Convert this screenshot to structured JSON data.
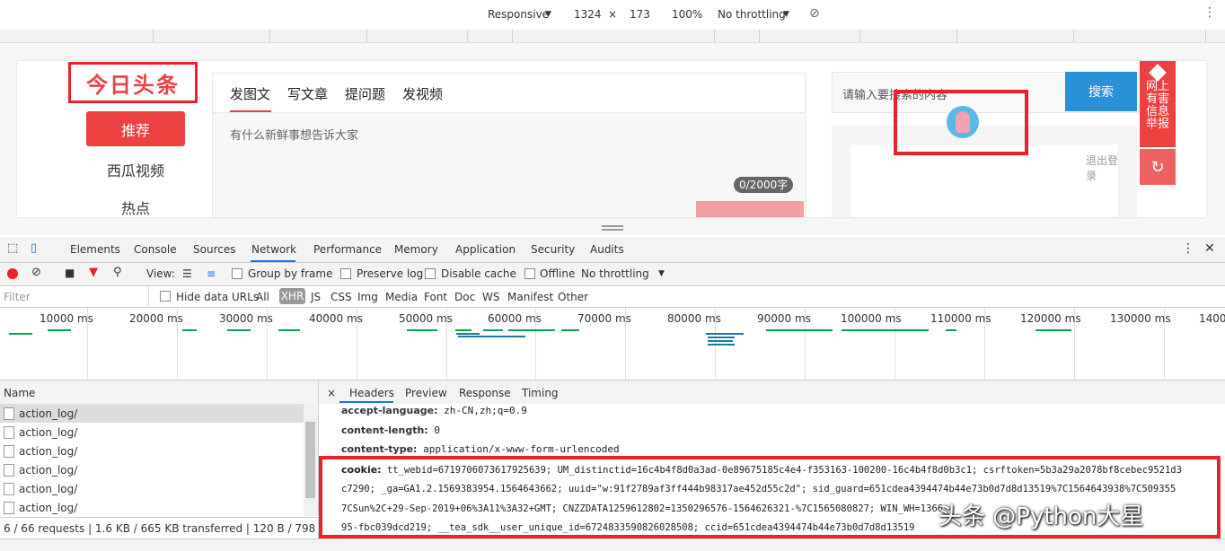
{
  "device_toolbar": {
    "device": "Responsive",
    "width": "1324",
    "times": "×",
    "height": "173",
    "zoom": "100%",
    "throttling": "No throttling"
  },
  "page": {
    "logo": "今日头条",
    "nav": [
      "推荐",
      "西瓜视频",
      "热点"
    ],
    "compose_tabs": [
      "发图文",
      "写文章",
      "提问题",
      "发视频"
    ],
    "compose_placeholder": "有什么新鲜事想告诉大家",
    "counter": "0/2000字",
    "search_placeholder": "请输入要搜索的内容",
    "search_button": "搜索",
    "report": "网上有害信息举报",
    "logout": "退出登录"
  },
  "devtools": {
    "tabs": [
      "Elements",
      "Console",
      "Sources",
      "Network",
      "Performance",
      "Memory",
      "Application",
      "Security",
      "Audits"
    ],
    "toolbar": {
      "view": "View:",
      "group_by_frame": "Group by frame",
      "preserve_log": "Preserve log",
      "disable_cache": "Disable cache",
      "offline": "Offline",
      "throttling": "No throttling"
    },
    "filter": {
      "placeholder": "Filter",
      "hide_data_urls": "Hide data URLs",
      "types": [
        "All",
        "XHR",
        "JS",
        "CSS",
        "Img",
        "Media",
        "Font",
        "Doc",
        "WS",
        "Manifest",
        "Other"
      ]
    },
    "timeline_labels": [
      "10000 ms",
      "20000 ms",
      "30000 ms",
      "40000 ms",
      "50000 ms",
      "60000 ms",
      "70000 ms",
      "80000 ms",
      "90000 ms",
      "100000 ms",
      "110000 ms",
      "120000 ms",
      "130000 ms",
      "1400"
    ],
    "name_header": "Name",
    "requests": [
      "action_log/",
      "action_log/",
      "action_log/",
      "action_log/",
      "action_log/",
      "action_log/"
    ],
    "status": "6 / 66 requests  |  1.6 KB / 665 KB transferred  |  120 B / 798 KB re...",
    "detail_tabs": [
      "×",
      "Headers",
      "Preview",
      "Response",
      "Timing"
    ],
    "headers": [
      {
        "k": "accept-language:",
        "v": "zh-CN,zh;q=0.9"
      },
      {
        "k": "content-length:",
        "v": "0"
      },
      {
        "k": "content-type:",
        "v": "application/x-www-form-urlencoded"
      }
    ],
    "cookie_key": "cookie:",
    "cookie_lines": [
      "tt_webid=6719706073617925639; UM_distinctid=16c4b4f8d0a3ad-0e89675185c4e4-f353163-100200-16c4b4f8d0b3c1; csrftoken=5b3a29a2078bf8cebec9521d3",
      "c7290; _ga=GA1.2.1569383954.1564643662; uuid=\"w:91f2789af3ff444b98317ae452d55c2d\"; sid_guard=651cdea4394474b44e73b0d7d8d13519%7C1564643938%7C509355",
      "7CSun%2C+29-Sep-2019+06%3A11%3A32+GMT; CNZZDATA1259612802=1350296576-1564626321-%7C1565080827; WIN_WH=1366_",
      "95-fbc039dcd219; __tea_sdk__user_unique_id=6724833590826028508; ccid=651cdea4394474b44e73b0d7d8d13519"
    ],
    "watermark": "头条 @Python大星"
  }
}
